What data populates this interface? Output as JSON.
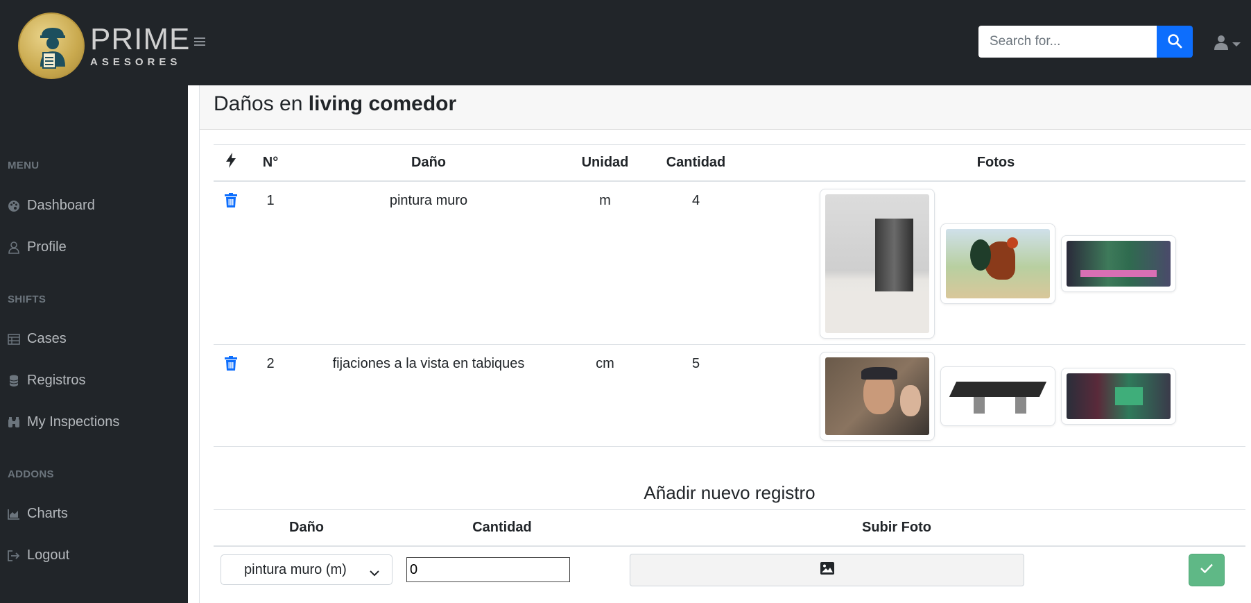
{
  "brand": {
    "name": "PRIME",
    "subtitle": "ASESORES"
  },
  "header": {
    "menu_icon": "hamburger-icon",
    "search": {
      "placeholder": "Search for...",
      "value": ""
    }
  },
  "sidebar": {
    "sections": [
      {
        "heading": "MENU",
        "items": [
          {
            "label": "Dashboard",
            "icon": "palette-icon"
          },
          {
            "label": "Profile",
            "icon": "user-icon"
          }
        ]
      },
      {
        "heading": "SHIFTS",
        "items": [
          {
            "label": "Cases",
            "icon": "table-icon"
          },
          {
            "label": "Registros",
            "icon": "database-icon"
          },
          {
            "label": "My Inspections",
            "icon": "binoculars-icon"
          }
        ]
      },
      {
        "heading": "ADDONS",
        "items": [
          {
            "label": "Charts",
            "icon": "chart-area-icon"
          },
          {
            "label": "Logout",
            "icon": "logout-icon"
          }
        ]
      }
    ]
  },
  "page": {
    "title_prefix": "Daños en",
    "title_room": "living comedor"
  },
  "damage_table": {
    "headers": {
      "action_icon": "bolt-icon",
      "num": "N°",
      "dano": "Daño",
      "unidad": "Unidad",
      "cantidad": "Cantidad",
      "fotos": "Fotos"
    },
    "rows": [
      {
        "num": "1",
        "dano": "pintura muro",
        "unidad": "m",
        "cantidad": "4",
        "photos": [
          "bedroom-photo",
          "rooster-photo",
          "circuit-board-photo"
        ]
      },
      {
        "num": "2",
        "dano": "fijaciones a la vista en tabiques",
        "unidad": "cm",
        "cantidad": "5",
        "photos": [
          "selfie-photo",
          "3d-model-photo",
          "electronics-photo"
        ]
      }
    ]
  },
  "new_record": {
    "title": "Añadir nuevo registro",
    "headers": {
      "dano": "Daño",
      "cantidad": "Cantidad",
      "subir_foto": "Subir Foto"
    },
    "selected_dano": "pintura muro (m)",
    "cantidad_value": "0"
  },
  "colors": {
    "navbar": "#212529",
    "accent": "#0d6efd",
    "success": "#5fb886"
  }
}
